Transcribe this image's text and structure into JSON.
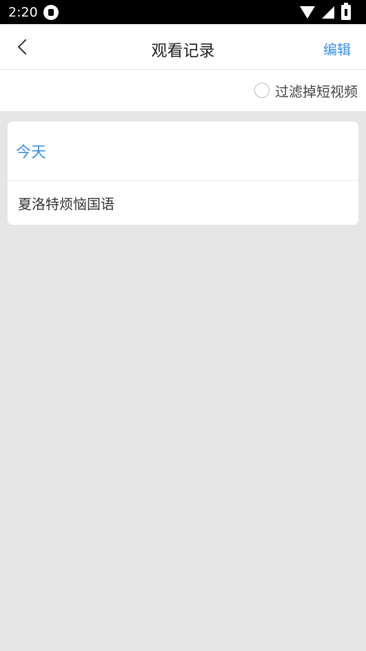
{
  "status_bar": {
    "time": "2:20"
  },
  "app_bar": {
    "title": "观看记录",
    "edit_label": "编辑"
  },
  "filter": {
    "label": "过滤掉短视频",
    "checked": false
  },
  "history": {
    "sections": [
      {
        "header": "今天",
        "items": [
          "夏洛特烦恼国语"
        ]
      }
    ]
  },
  "colors": {
    "accent": "#3a8ee6",
    "background": "#e6e6e6"
  }
}
